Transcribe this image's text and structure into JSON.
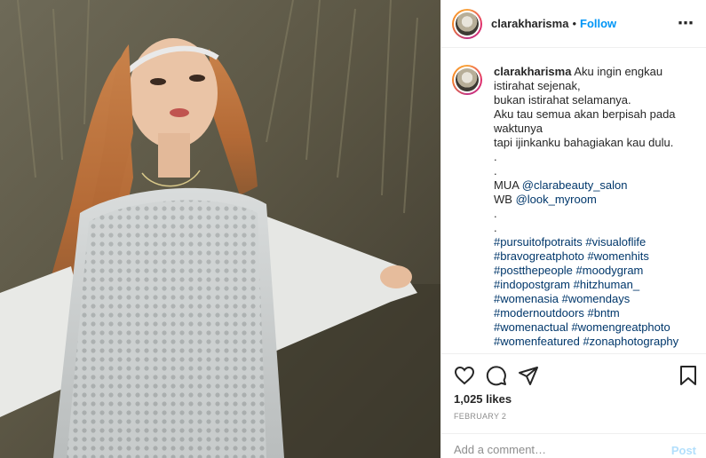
{
  "post": {
    "username": "clarakharisma",
    "separator": "•",
    "follow_label": "Follow",
    "more_icon": "⋯",
    "caption": {
      "username": "clarakharisma",
      "lines": [
        "Aku ingin engkau istirahat sejenak,",
        "bukan istirahat selamanya.",
        "Aku tau semua akan berpisah pada waktunya",
        "tapi ijinkanku bahagiakan kau dulu.",
        ".",
        "."
      ],
      "mua_label": "MUA",
      "mua_link": "@clarabeauty_salon",
      "wb_label": "WB",
      "wb_link": "@look_myroom",
      "dots": [
        ".",
        "."
      ],
      "hashtag_lines": [
        "#pursuitofpotraits #visualoflife",
        "#bravogreatphoto #womenhits",
        "#postthepeople #moodygram",
        "#indopostgram #hitzhuman_",
        "#womenasia #womendays",
        "#modernoutdoors #bntm",
        "#womenactual #womengreatphoto",
        "#womenfeatured #zonaphotography"
      ]
    },
    "likes": "1,025 likes",
    "date": "FEBRUARY 2",
    "comment_placeholder": "Add a comment…",
    "post_label": "Post",
    "icons": [
      "heart-icon",
      "comment-icon",
      "share-icon",
      "bookmark-icon"
    ],
    "colors": {
      "link": "#0095f6",
      "mention": "#00376b",
      "post_disabled": "#b2dffc"
    }
  }
}
